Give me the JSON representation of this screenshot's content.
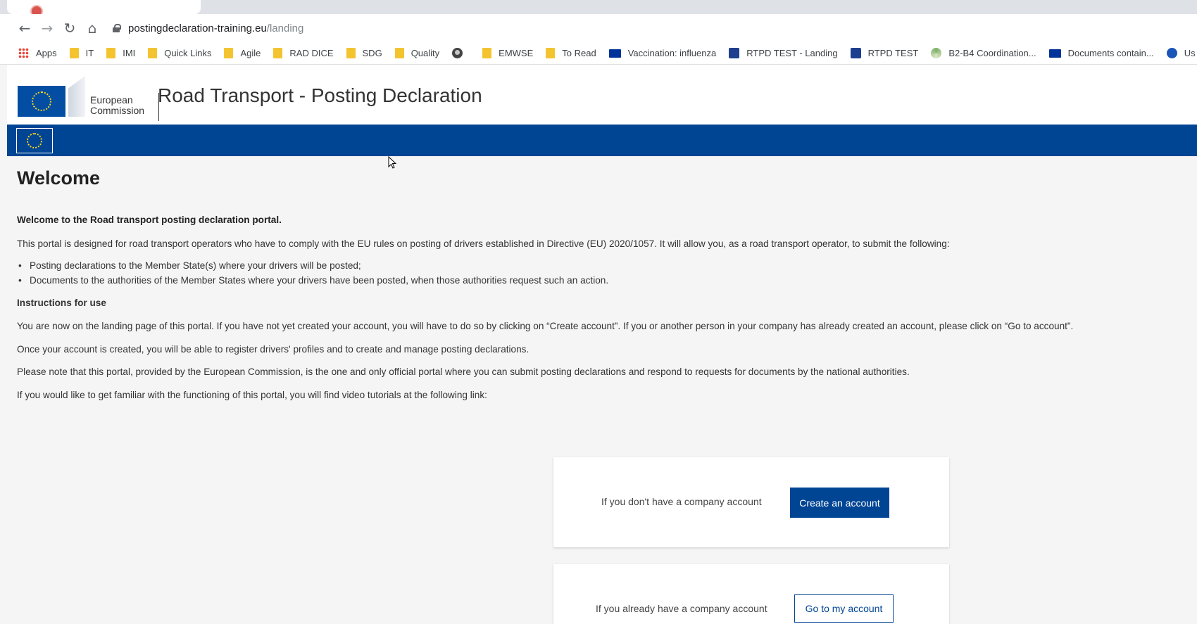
{
  "browser": {
    "url_host": "postingdeclaration-training.eu",
    "url_path": "/landing",
    "bookmarks": [
      {
        "label": "Apps",
        "icon": "apps-grid-icon"
      },
      {
        "label": "IT",
        "icon": "folder-icon"
      },
      {
        "label": "IMI",
        "icon": "folder-icon"
      },
      {
        "label": "Quick Links",
        "icon": "folder-icon"
      },
      {
        "label": "Agile",
        "icon": "folder-icon"
      },
      {
        "label": "RAD DICE",
        "icon": "folder-icon"
      },
      {
        "label": "SDG",
        "icon": "folder-icon"
      },
      {
        "label": "Quality",
        "icon": "folder-icon"
      },
      {
        "label": "",
        "icon": "globe-icon"
      },
      {
        "label": "EMWSE",
        "icon": "folder-icon"
      },
      {
        "label": "To Read",
        "icon": "folder-icon"
      },
      {
        "label": "Vaccination: influenza",
        "icon": "eu-flag-icon"
      },
      {
        "label": "RTPD TEST - Landing",
        "icon": "rtpd-icon"
      },
      {
        "label": "RTPD TEST",
        "icon": "rtpd-icon"
      },
      {
        "label": "B2-B4 Coordination...",
        "icon": "coordination-icon"
      },
      {
        "label": "Documents contain...",
        "icon": "eu-flag-icon"
      },
      {
        "label": "Us",
        "icon": "user-icon"
      }
    ]
  },
  "header": {
    "logo_line1": "European",
    "logo_line2": "Commission",
    "title": "Road Transport - Posting Declaration"
  },
  "main": {
    "title": "Welcome",
    "intro_bold": "Welcome to the Road transport posting declaration portal.",
    "intro": "This portal is designed for road transport operators who have to comply with the EU rules on posting of drivers established in Directive (EU) 2020/1057. It will allow you, as a road transport operator, to submit the following:",
    "bullets": [
      "Posting declarations to the Member State(s) where your drivers will be posted;",
      "Documents to the authorities of the Member States where your drivers have been posted, when those authorities request such an action."
    ],
    "instructions_heading": "Instructions for use",
    "instructions": [
      "You are now on the landing page of this portal. If you have not yet created your account, you will have to do so by clicking on “Create account”. If you or another person in your company has already created an account, please click on “Go to account”.",
      "Once your account is created, you will be able to register drivers' profiles and to create and manage posting declarations.",
      "Please note that this portal, provided by the European Commission, is the one and only official portal where you can submit posting declarations and respond to requests for documents by the national authorities.",
      "If you would like to get familiar with the functioning of this portal, you will find video tutorials at the following link:"
    ]
  },
  "cards": {
    "create": {
      "text": "If you don't have a company account",
      "button": "Create an account"
    },
    "login": {
      "text": "If you already have a company account",
      "button": "Go to my account"
    }
  },
  "colors": {
    "brand_blue": "#004494",
    "eu_flag": "#034ea2",
    "eu_star": "#ffd617"
  }
}
